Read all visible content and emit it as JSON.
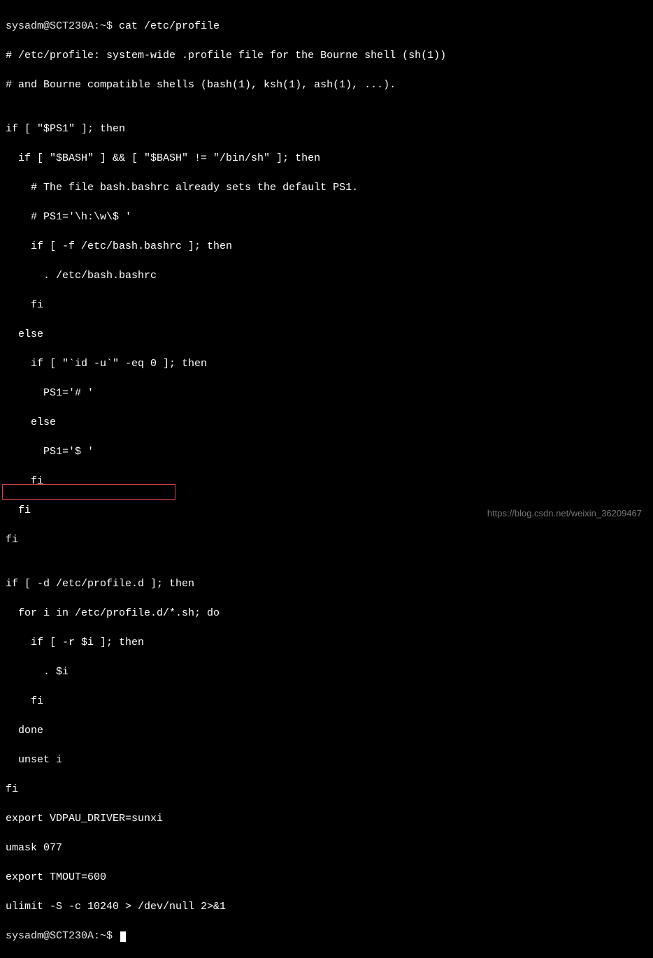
{
  "prompt1": "sysadm@SCT230A:~$ ",
  "command1": "cat /etc/profile",
  "lines": [
    "# /etc/profile: system-wide .profile file for the Bourne shell (sh(1))",
    "# and Bourne compatible shells (bash(1), ksh(1), ash(1), ...).",
    "",
    "if [ \"$PS1\" ]; then",
    "  if [ \"$BASH\" ] && [ \"$BASH\" != \"/bin/sh\" ]; then",
    "    # The file bash.bashrc already sets the default PS1.",
    "    # PS1='\\h:\\w\\$ '",
    "    if [ -f /etc/bash.bashrc ]; then",
    "      . /etc/bash.bashrc",
    "    fi",
    "  else",
    "    if [ \"`id -u`\" -eq 0 ]; then",
    "      PS1='# '",
    "    else",
    "      PS1='$ '",
    "    fi",
    "  fi",
    "fi",
    "",
    "if [ -d /etc/profile.d ]; then",
    "  for i in /etc/profile.d/*.sh; do",
    "    if [ -r $i ]; then",
    "      . $i",
    "    fi",
    "  done",
    "  unset i",
    "fi",
    "export VDPAU_DRIVER=sunxi",
    "umask 077",
    "export TMOUT=600",
    "ulimit -S -c 10240 > /dev/null 2>&1"
  ],
  "prompt2": "sysadm@SCT230A:~$ ",
  "watermark": "https://blog.csdn.net/weixin_36209467"
}
